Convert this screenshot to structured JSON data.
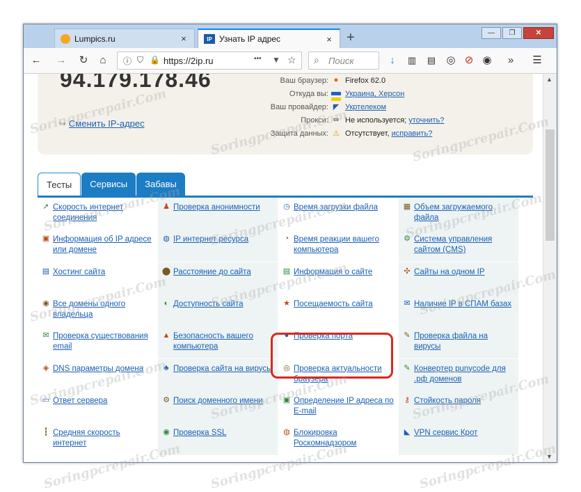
{
  "window": {
    "controls": [
      "—",
      "❐",
      "✕"
    ]
  },
  "tabs": [
    {
      "title": "Lumpics.ru",
      "close": "×"
    },
    {
      "title": "Узнать IP адрес",
      "close": "×",
      "favicon_text": "IP"
    }
  ],
  "new_tab": "+",
  "toolbar": {
    "url": "https://2ip.ru",
    "search_placeholder": "Поиск",
    "page_actions": "•••"
  },
  "ip_info": {
    "ip": "94.179.178.46",
    "change_ip": "Сменить IP-адрес",
    "rows": [
      {
        "label": "Ваш браузер:",
        "value": "Firefox 62.0",
        "icon": "firefox-icon",
        "link": ""
      },
      {
        "label": "Откуда вы:",
        "value": "Украина, Херсон",
        "icon": "ukraine-flag-icon",
        "link": ""
      },
      {
        "label": "Ваш провайдер:",
        "value": "Укртелеком",
        "icon": "provider-icon",
        "link": ""
      },
      {
        "label": "Прокси:",
        "value": "Не используется;",
        "icon": "glasses-icon",
        "link": "уточнить?"
      },
      {
        "label": "Защита данных:",
        "value": "Отсутствует,",
        "icon": "warning-icon",
        "link": "исправить?"
      }
    ]
  },
  "page_tabs": [
    "Тесты",
    "Сервисы",
    "Забавы"
  ],
  "services": [
    [
      "Скорость интернет соединения",
      "Проверка анонимности",
      "Время загрузки файла",
      "Объем загружаемого файла"
    ],
    [
      "Информация об IP адресе или домене",
      "IP интернет ресурса",
      "Время реакции вашего компьютера",
      "Система управления сайтом (CMS)"
    ],
    [
      "Хостинг сайта",
      "Расстояние до сайта",
      "Информация о сайте",
      "Сайты на одном IP"
    ],
    [
      "Все домены одного владельца",
      "Доступность сайта",
      "Посещаемость сайта",
      "Наличие IP в СПАМ базах"
    ],
    [
      "Проверка существования email",
      "Безопасность вашего компьютера",
      "Проверка порта",
      "Проверка файла на вирусы"
    ],
    [
      "DNS параметры домена",
      "Проверка сайта на вирусы",
      "Проверка актуальности браузера",
      "Конвертер punycode для .рф доменов"
    ],
    [
      "Ответ сервера",
      "Поиск доменного имени",
      "Определение IP адреса по E-mail",
      "Стойкость пароля"
    ],
    [
      "Средняя скорость интернет",
      "Проверка SSL",
      "Блокировка Роскомнадзором",
      "VPN сервис Крот"
    ]
  ],
  "service_icons": [
    [
      "speed-icon",
      "anonymity-icon",
      "clock-icon",
      "file-size-icon"
    ],
    [
      "ip-info-icon",
      "ip-resource-icon",
      "reaction-icon",
      "cms-icon"
    ],
    [
      "hosting-icon",
      "pin-icon",
      "document-icon",
      "sites-icon"
    ],
    [
      "domains-icon",
      "availability-icon",
      "star-icon",
      "spam-icon"
    ],
    [
      "email-icon",
      "lock-icon",
      "globe-icon",
      "virus-file-icon"
    ],
    [
      "dns-icon",
      "virus-site-icon",
      "browser-icon",
      "punycode-icon"
    ],
    [
      "server-icon",
      "domain-search-icon",
      "email-ip-icon",
      "password-icon"
    ],
    [
      "avg-speed-icon",
      "ssl-icon",
      "block-icon",
      "vpn-icon"
    ]
  ],
  "highlighted_service": "Проверка порта",
  "watermark": "Soringpcrepair.Com"
}
